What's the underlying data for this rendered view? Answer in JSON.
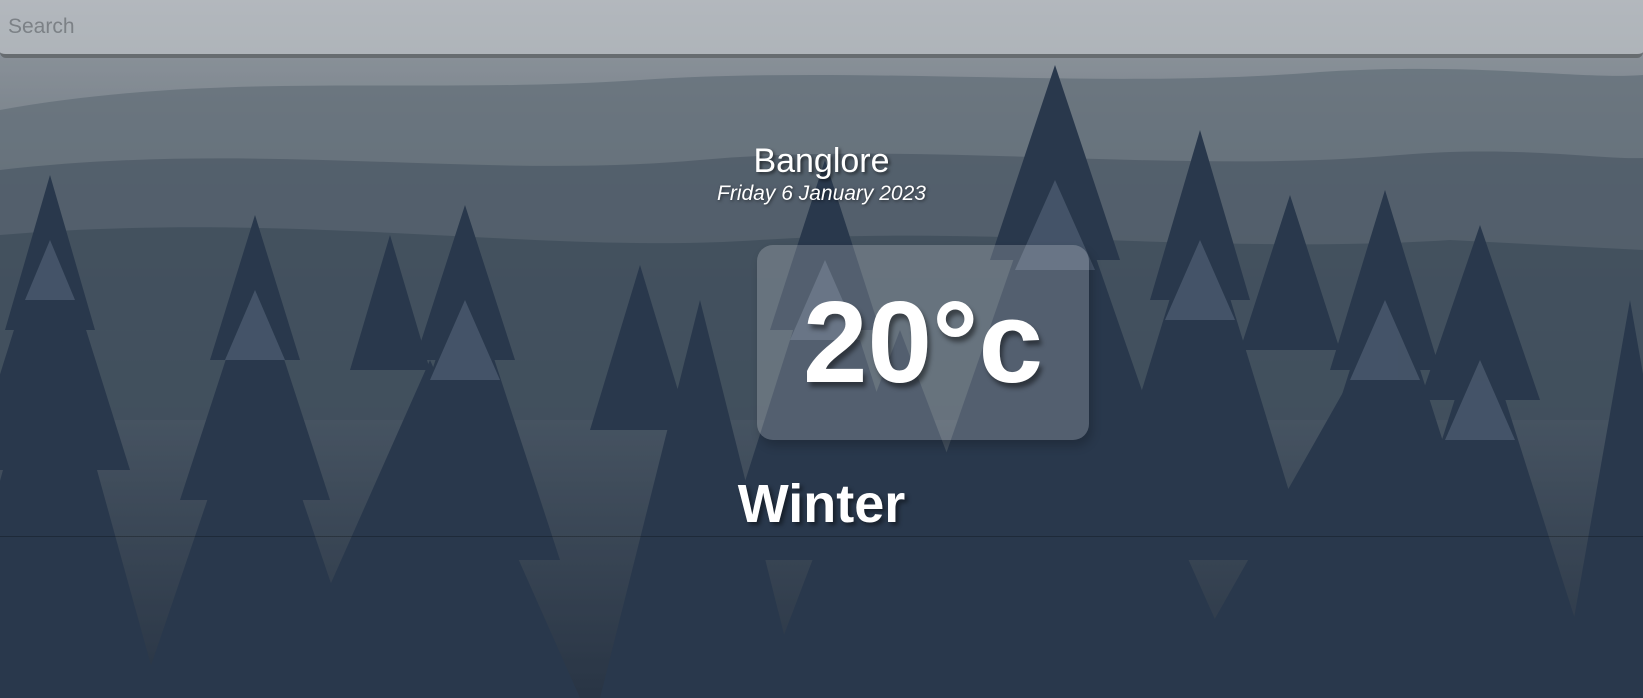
{
  "search": {
    "placeholder": "Search",
    "value": ""
  },
  "location": {
    "city": "Banglore",
    "date": "Friday 6 January 2023"
  },
  "weather": {
    "temperature": "20°c",
    "season": "Winter"
  },
  "colors": {
    "text": "#ffffff",
    "search_bar_bg": "#cdd2d6",
    "search_bar_border": "#5a5f64",
    "temp_box_bg": "rgba(255,255,255,0.2)"
  },
  "background": {
    "description_icon": "snowy-pine-forest-image"
  }
}
